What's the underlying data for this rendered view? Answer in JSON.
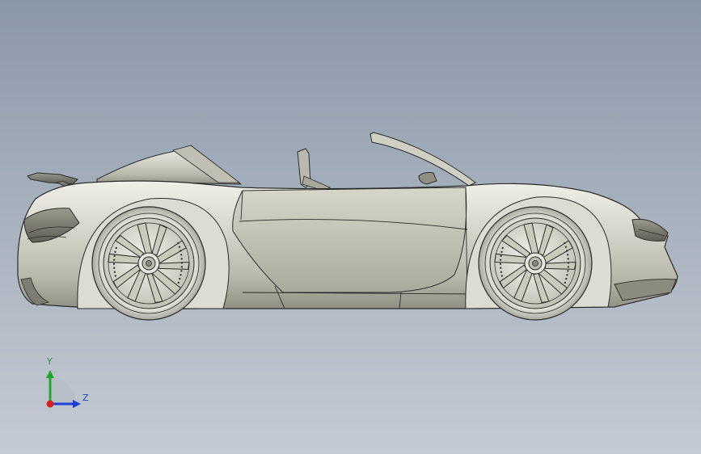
{
  "viewport": {
    "background_top": "#8a97a9",
    "background_bottom": "#c4cad3",
    "model": {
      "name": "sports-convertible-car",
      "view": "side view",
      "body_color": "#c9c9bf",
      "edge_color": "#2b2b2b"
    }
  },
  "triad": {
    "y_label": "Y",
    "z_label": "Z",
    "y_color": "#1fa82c",
    "z_color": "#1f3fd6",
    "x_color": "#d62020"
  }
}
